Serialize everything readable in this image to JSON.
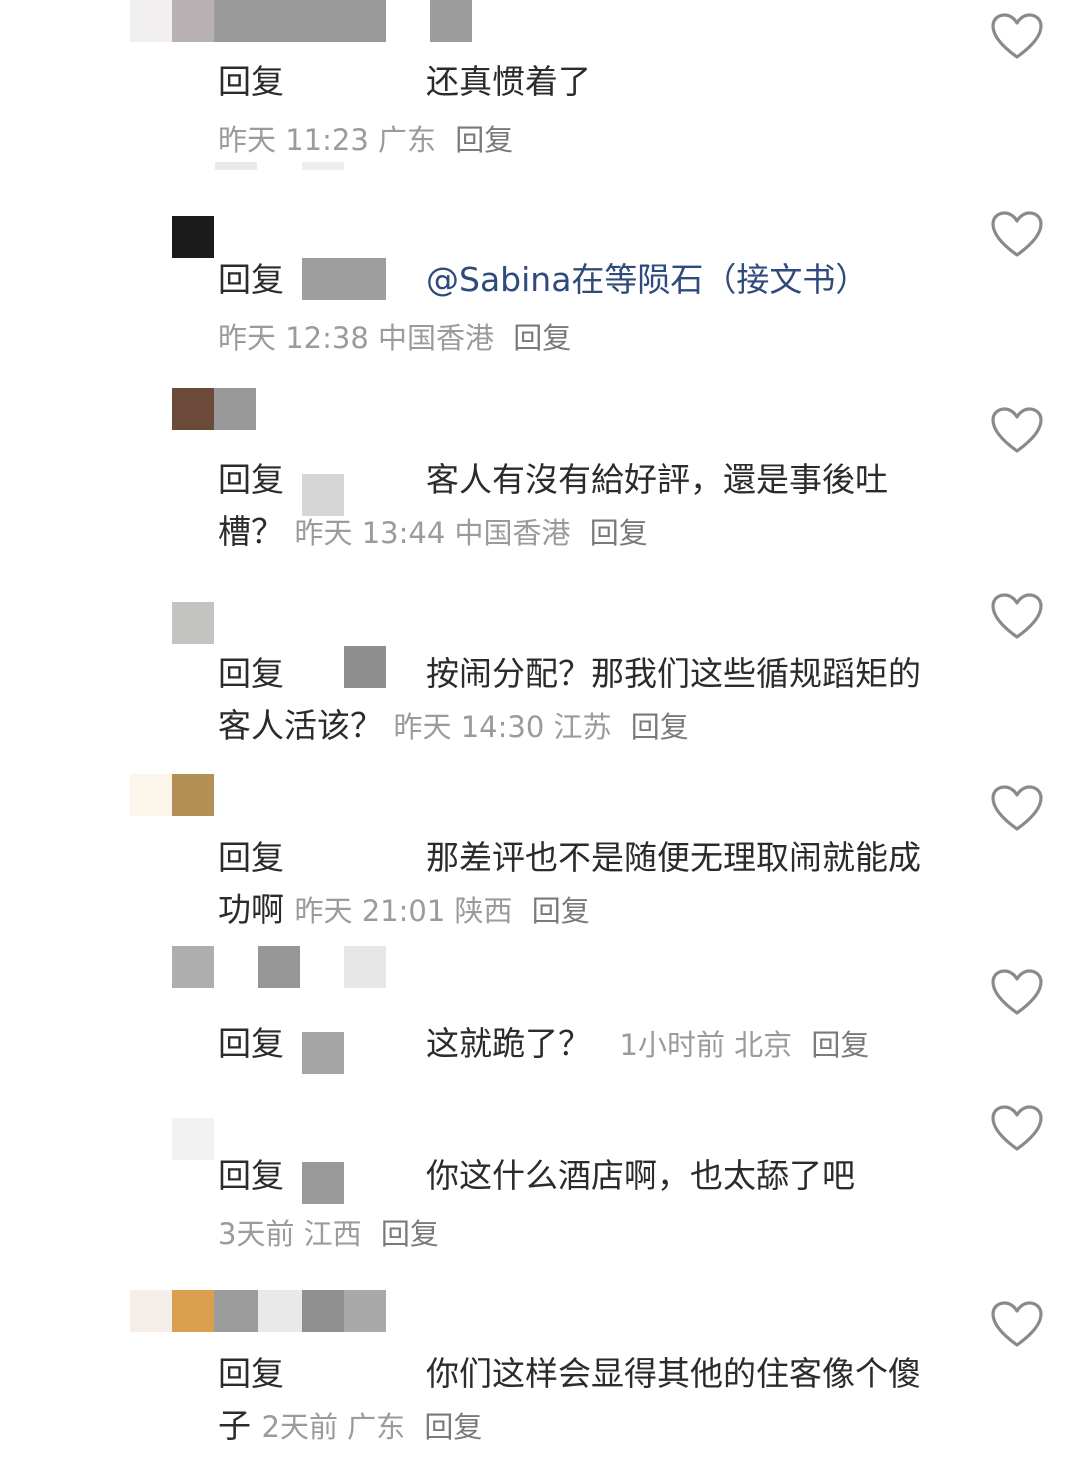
{
  "reply_prefix": "回复",
  "reply_action": "回复",
  "comments": [
    {
      "text": "还真惯着了",
      "time": "昨天 11:23",
      "location": "广东",
      "avatar_colors": [
        "#f1eff0",
        "#b7b1b3",
        "#9a9a9a",
        "#9c9c9c"
      ]
    },
    {
      "mention": "@Sabina在等陨石（接文书）",
      "time": "昨天 12:38",
      "location": "中国香港",
      "avatar_colors": [
        "#1b1b1b"
      ]
    },
    {
      "text": "客人有沒有給好評，還是事後吐槽？",
      "time": "昨天 13:44",
      "location": "中国香港",
      "avatar_colors": [
        "#6b4a39",
        "#999999"
      ]
    },
    {
      "text": "按闹分配？那我们这些循规蹈矩的客人活该？",
      "time": "昨天 14:30",
      "location": "江苏",
      "avatar_colors": [
        "#c3c4bf"
      ]
    },
    {
      "text": "那差评也不是随便无理取闹就能成功啊",
      "time": "昨天 21:01",
      "location": "陕西",
      "avatar_colors": [
        "#fcf6ea",
        "#b39156"
      ]
    },
    {
      "text": "这就跪了？",
      "time": "1小时前",
      "location": "北京",
      "avatar_colors": [
        "#aeaeae",
        "#969696",
        "#e7e7e7"
      ]
    },
    {
      "text": "你这什么酒店啊，也太舔了吧",
      "time": "3天前",
      "location": "江西",
      "avatar_colors": [
        "#f2f2f2"
      ]
    },
    {
      "text": "你们这样会显得其他的住客像个傻子",
      "time": "2天前",
      "location": "广东",
      "avatar_colors": [
        "#f6efe9",
        "#dba04f",
        "#9c9c9c",
        "#e9e9e9",
        "#8f8f8f",
        "#a9a9a9"
      ]
    }
  ]
}
